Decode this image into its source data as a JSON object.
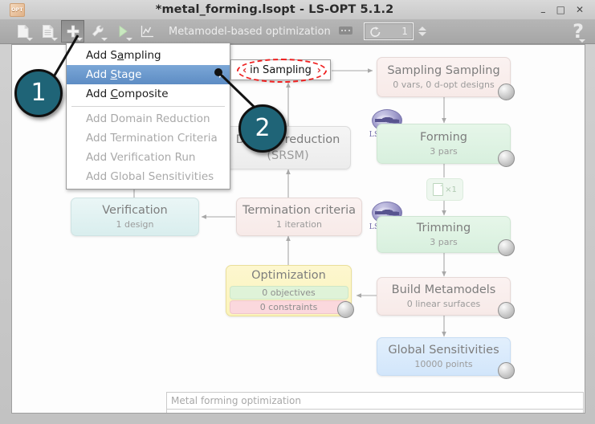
{
  "window": {
    "app_icon_text": "OPT",
    "title": "*metal_forming.lsopt - LS-OPT 5.1.2",
    "minimize": "–",
    "maximize": "□",
    "close": "✕"
  },
  "toolbar": {
    "buttons": [
      {
        "name": "new-file-icon",
        "label": "New"
      },
      {
        "name": "save-file-icon",
        "label": "Save"
      },
      {
        "name": "add-icon",
        "label": "Add"
      },
      {
        "name": "tools-icon",
        "label": "Tools"
      },
      {
        "name": "run-icon",
        "label": "Run"
      },
      {
        "name": "plot-icon",
        "label": "Viewer"
      }
    ],
    "task_label": "Metamodel-based optimization",
    "iteration_value": "1",
    "help_label": "?"
  },
  "menu": {
    "items": [
      {
        "label": "Add Sampling",
        "mnemonic": "a",
        "selected": false,
        "disabled": false,
        "submenu": false
      },
      {
        "label": "Add Stage",
        "mnemonic": "S",
        "selected": true,
        "disabled": false,
        "submenu": true
      },
      {
        "label": "Add Composite",
        "mnemonic": "C",
        "selected": false,
        "disabled": false,
        "submenu": false
      },
      {
        "label": "Add Domain Reduction",
        "mnemonic": "",
        "selected": false,
        "disabled": true,
        "submenu": false
      },
      {
        "label": "Add Termination Criteria",
        "mnemonic": "",
        "selected": false,
        "disabled": true,
        "submenu": false
      },
      {
        "label": "Add Verification Run",
        "mnemonic": "",
        "selected": false,
        "disabled": true,
        "submenu": false
      },
      {
        "label": "Add Global Sensitivities",
        "mnemonic": "",
        "selected": false,
        "disabled": true,
        "submenu": false
      }
    ],
    "submenu": {
      "label": "in Sampling",
      "highlight_color": "#ef2020",
      "left_chevron": "‹",
      "right_chevron": "›"
    }
  },
  "callouts": [
    {
      "id": "1",
      "label": "1",
      "color": "#1f6477"
    },
    {
      "id": "2",
      "label": "2",
      "color": "#1f6477"
    }
  ],
  "flowchart": {
    "nodes": [
      {
        "name": "sampling-sampling",
        "title": "Sampling Sampling",
        "subtitle": "0 vars, 0 d-opt designs",
        "color": "pink"
      },
      {
        "name": "forming",
        "title": "Forming",
        "subtitle": "3 pars",
        "color": "green",
        "solver": "LS-DYNA"
      },
      {
        "name": "trimming",
        "title": "Trimming",
        "subtitle": "3 pars",
        "color": "green",
        "solver": "LS-DYNA"
      },
      {
        "name": "build-metamodels",
        "title": "Build Metamodels",
        "subtitle": "0 linear surfaces",
        "color": "pink"
      },
      {
        "name": "global-sensitivities",
        "title": "Global Sensitivities",
        "subtitle": "10000 points",
        "color": "blue"
      },
      {
        "name": "domain-reduction",
        "title": "Domain reduction",
        "subtitle": "(SRSM)",
        "color": "grey"
      },
      {
        "name": "termination-criteria",
        "title": "Termination criteria",
        "subtitle": "1 iteration",
        "color": "pink"
      },
      {
        "name": "verification",
        "title": "Verification",
        "subtitle": "1 design",
        "color": "teal"
      },
      {
        "name": "optimization",
        "title": "Optimization",
        "objectives": "0 objectives",
        "constraints": "0 constraints",
        "color": "yellow"
      }
    ],
    "file_transfer_chip": "×1",
    "solver_badge": "LS-DYNA"
  },
  "bottom": {
    "description_value": "Metal forming optimization",
    "notes_value": ""
  }
}
